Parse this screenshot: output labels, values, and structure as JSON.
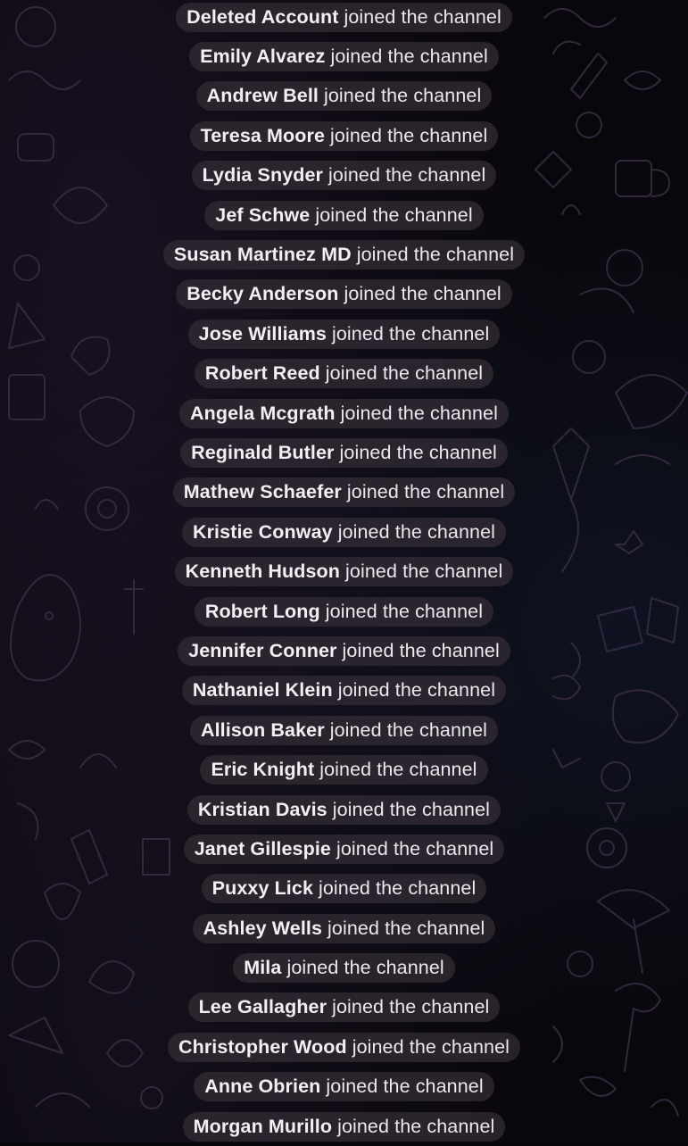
{
  "service_messages": {
    "action_text": "joined the channel",
    "items": [
      {
        "name": "Deleted Account"
      },
      {
        "name": "Emily Alvarez"
      },
      {
        "name": "Andrew Bell"
      },
      {
        "name": "Teresa Moore"
      },
      {
        "name": "Lydia Snyder"
      },
      {
        "name": "Jef Schwe"
      },
      {
        "name": "Susan Martinez MD"
      },
      {
        "name": "Becky Anderson"
      },
      {
        "name": "Jose Williams"
      },
      {
        "name": "Robert Reed"
      },
      {
        "name": "Angela Mcgrath"
      },
      {
        "name": "Reginald Butler"
      },
      {
        "name": "Mathew Schaefer"
      },
      {
        "name": "Kristie Conway"
      },
      {
        "name": "Kenneth Hudson"
      },
      {
        "name": "Robert Long"
      },
      {
        "name": "Jennifer Conner"
      },
      {
        "name": "Nathaniel Klein"
      },
      {
        "name": "Allison Baker"
      },
      {
        "name": "Eric Knight"
      },
      {
        "name": "Kristian Davis"
      },
      {
        "name": "Janet Gillespie"
      },
      {
        "name": "Puxxy Lick"
      },
      {
        "name": "Ashley Wells"
      },
      {
        "name": "Mila"
      },
      {
        "name": "Lee Gallagher"
      },
      {
        "name": "Christopher Wood"
      },
      {
        "name": "Anne Obrien"
      },
      {
        "name": "Morgan Murillo"
      }
    ]
  },
  "theme": {
    "background": "#08070b",
    "pill_background": "#302a32",
    "text_color": "#f2f0f4",
    "doodle_stroke": "#3a2d45"
  }
}
